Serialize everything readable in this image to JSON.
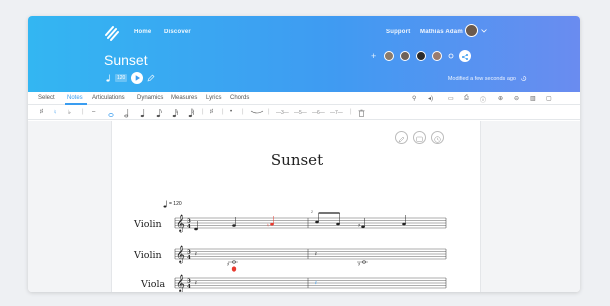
{
  "nav": {
    "home": "Home",
    "discover": "Discover",
    "support": "Support",
    "user_name": "Mathias Adam"
  },
  "project": {
    "title": "Sunset",
    "tempo_value": "120",
    "modified_text": "Modified a few seconds ago",
    "share_plus": "+"
  },
  "tabs": [
    "Select",
    "Notes",
    "Articulations",
    "Dynamics",
    "Measures",
    "Lyrics",
    "Chords"
  ],
  "active_tab": "Notes",
  "toolbar": {
    "accidentals": [
      "♯",
      "♮",
      "♭"
    ],
    "dash": "–",
    "dot_label": "•",
    "tuplet_label": "—3—",
    "tuplet2_label": "—5—",
    "tuplet3_label": "—6—",
    "tuplet4_label": "—7—"
  },
  "score": {
    "title": "Sunset",
    "tempo_marking": "= 120",
    "instruments": [
      "Violin",
      "Violin",
      "Viola"
    ],
    "measure_number": "2"
  },
  "colors": {
    "header_start": "#33b6f2",
    "header_end": "#6a8cf0",
    "accent": "#3a9df0",
    "selection": "#e8392e"
  }
}
